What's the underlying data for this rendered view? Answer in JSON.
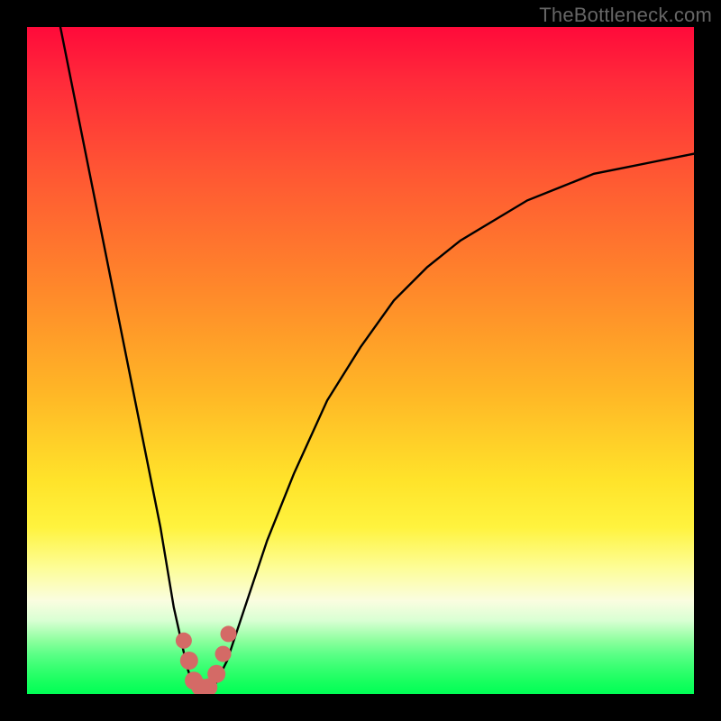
{
  "watermark": "TheBottleneck.com",
  "chart_data": {
    "type": "line",
    "title": "",
    "xlabel": "",
    "ylabel": "",
    "xlim": [
      0,
      100
    ],
    "ylim": [
      0,
      100
    ],
    "grid": false,
    "legend": false,
    "series": [
      {
        "name": "bottleneck-curve",
        "x": [
          5,
          10,
          15,
          20,
          22,
          24,
          25,
          26,
          27,
          28,
          30,
          33,
          36,
          40,
          45,
          50,
          55,
          60,
          65,
          70,
          75,
          80,
          85,
          90,
          95,
          100
        ],
        "values": [
          100,
          75,
          50,
          25,
          13,
          4,
          1,
          0,
          0,
          1,
          5,
          14,
          23,
          33,
          44,
          52,
          59,
          64,
          68,
          71,
          74,
          76,
          78,
          79,
          80,
          81
        ]
      }
    ],
    "markers": [
      {
        "x": 23.5,
        "y": 8,
        "color": "#d46a66",
        "size": 9
      },
      {
        "x": 24.3,
        "y": 5,
        "color": "#d46a66",
        "size": 10
      },
      {
        "x": 25.0,
        "y": 2,
        "color": "#d46a66",
        "size": 10
      },
      {
        "x": 26.0,
        "y": 1,
        "color": "#d46a66",
        "size": 10
      },
      {
        "x": 27.2,
        "y": 1,
        "color": "#d46a66",
        "size": 10
      },
      {
        "x": 28.4,
        "y": 3,
        "color": "#d46a66",
        "size": 10
      },
      {
        "x": 29.4,
        "y": 6,
        "color": "#d46a66",
        "size": 9
      },
      {
        "x": 30.2,
        "y": 9,
        "color": "#d46a66",
        "size": 9
      }
    ],
    "background_gradient": {
      "orientation": "vertical",
      "stops": [
        {
          "pos": 0.0,
          "color": "#ff0a3a"
        },
        {
          "pos": 0.4,
          "color": "#ff8a2a"
        },
        {
          "pos": 0.75,
          "color": "#fff33e"
        },
        {
          "pos": 0.9,
          "color": "#c7ffc3"
        },
        {
          "pos": 1.0,
          "color": "#00ff55"
        }
      ]
    }
  }
}
